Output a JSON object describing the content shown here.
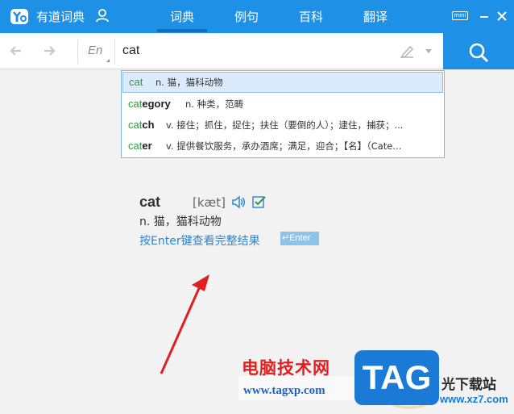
{
  "titlebar": {
    "app_name": "有道词典",
    "tabs": [
      {
        "label": "词典",
        "active": true
      },
      {
        "label": "例句",
        "active": false
      },
      {
        "label": "百科",
        "active": false
      },
      {
        "label": "翻译",
        "active": false
      }
    ],
    "mini_label": "mini"
  },
  "search": {
    "lang": "En",
    "query": "cat"
  },
  "suggestions": [
    {
      "hl": "cat",
      "rest": "",
      "def": "n. 猫，猫科动物",
      "selected": true
    },
    {
      "hl": "cat",
      "rest": "egory",
      "def": "n. 种类，范畴",
      "selected": false
    },
    {
      "hl": "cat",
      "rest": "ch",
      "def": "v. 接住；抓住，捉住；扶住（要倒的人）；逮住，捕获；...",
      "selected": false
    },
    {
      "hl": "cat",
      "rest": "er",
      "def": "v. 提供餐饮服务，承办酒席；满足，迎合；【名】（Cate...",
      "selected": false
    }
  ],
  "preview": {
    "word": "cat",
    "phonetic": "[kæt]",
    "definition": "n. 猫，猫科动物",
    "hint": "按Enter键查看完整结果",
    "enter_badge": "↵Enter"
  },
  "watermark": {
    "site_cn": "电脑技术网",
    "site_url": "www.tagxp.com",
    "tag": "TAG",
    "side_cn": "光下载站",
    "side_url": "www.xz7.com"
  },
  "colors": {
    "titlebar": "#1e90e6",
    "accent_link": "#2b86cf",
    "highlight_green": "#2e9a3e",
    "arrow_red": "#e02020"
  },
  "icons": [
    "youdao-logo-icon",
    "user-icon",
    "back-arrow-icon",
    "forward-arrow-icon",
    "handwriting-icon",
    "search-icon",
    "speaker-icon",
    "add-to-wordbook-icon",
    "minimize-icon",
    "close-icon"
  ]
}
